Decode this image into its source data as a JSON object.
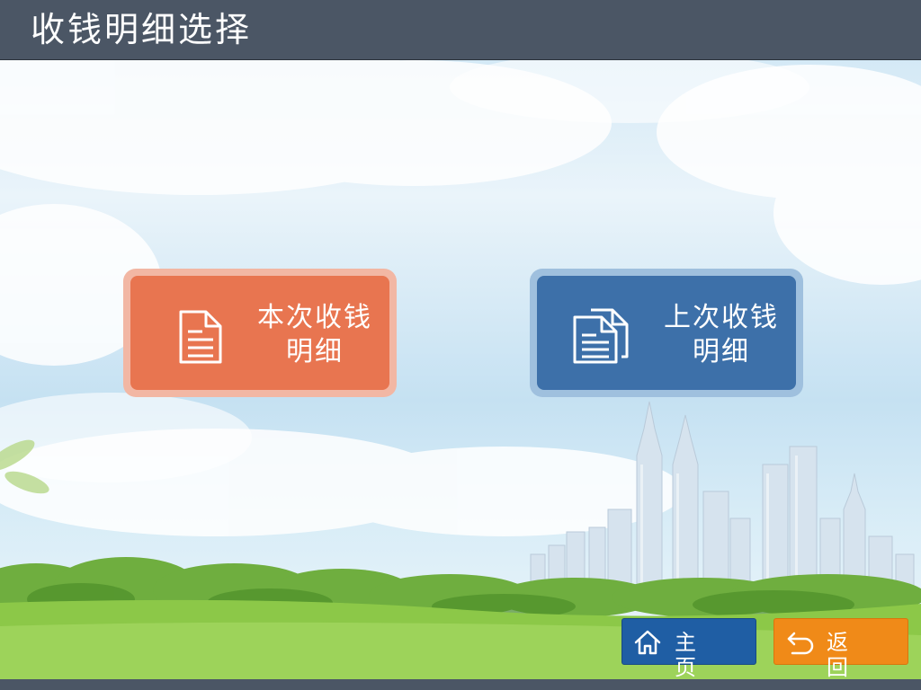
{
  "header": {
    "title": "收钱明细选择"
  },
  "cards": [
    {
      "id": "current",
      "label_line1": "本次收钱",
      "label_line2": "明细",
      "color": "#e87550",
      "frame_color": "#f2b7a4",
      "icon": "document-icon"
    },
    {
      "id": "previous",
      "label_line1": "上次收钱",
      "label_line2": "明细",
      "color": "#3d70a9",
      "frame_color": "#9fc0de",
      "icon": "documents-icon"
    }
  ],
  "nav": {
    "home_label": "主页",
    "back_label": "返回",
    "home_color": "#1f5ea4",
    "back_color": "#f08a18",
    "home_icon": "home-icon",
    "back_icon": "return-arrow-icon"
  }
}
